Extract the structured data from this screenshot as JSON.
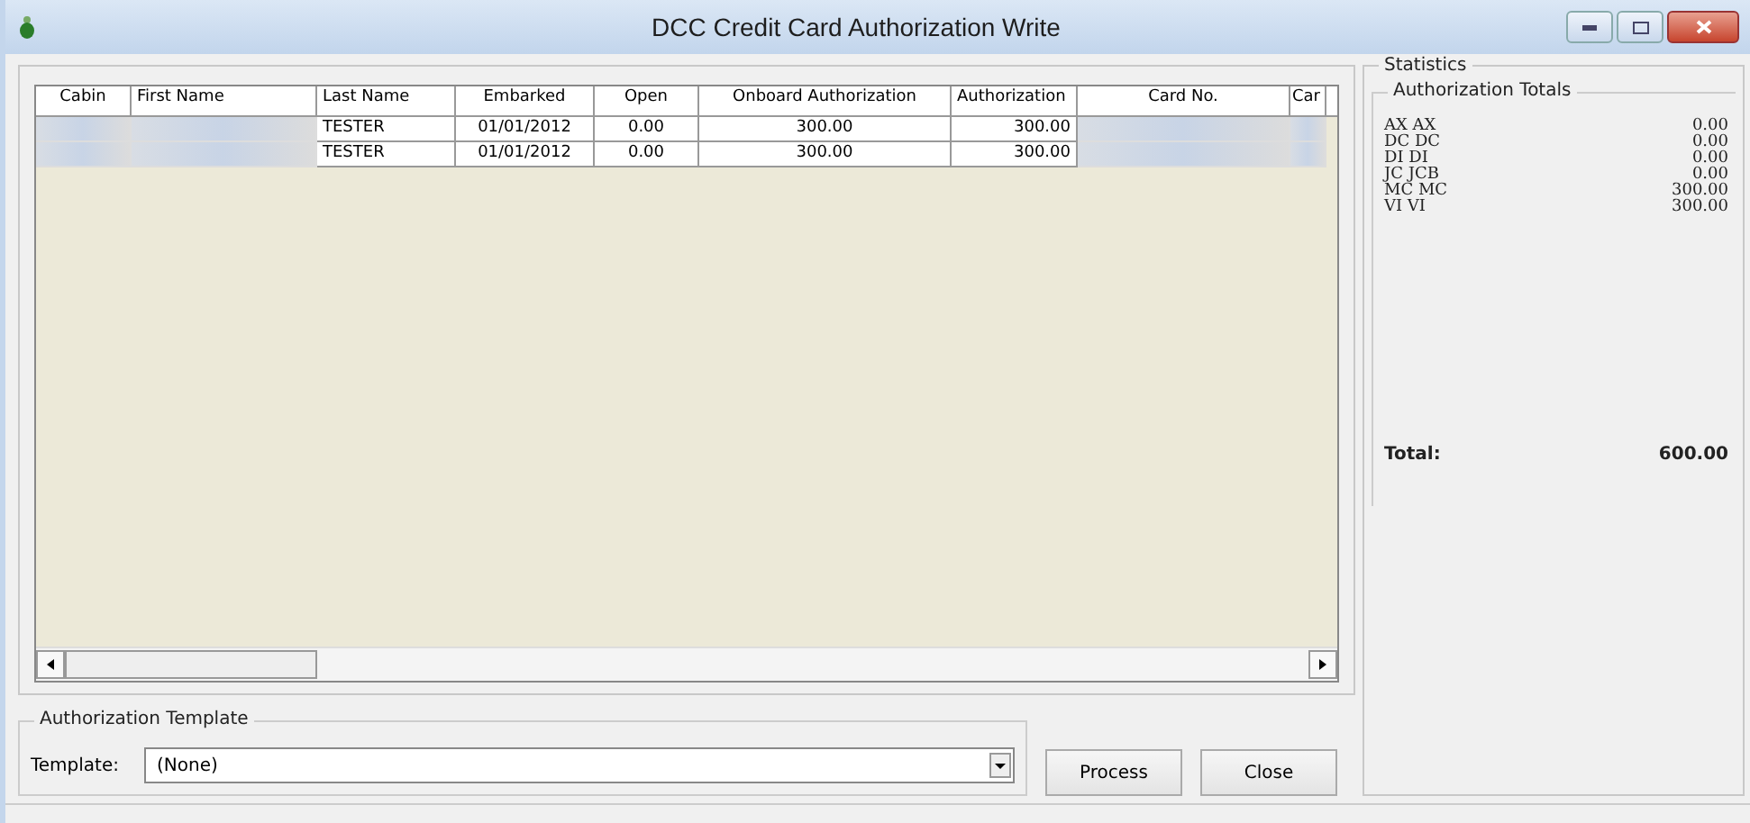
{
  "window": {
    "title": "DCC Credit Card Authorization Write"
  },
  "table": {
    "columns": [
      "Cabin",
      "First Name",
      "Last Name",
      "Embarked",
      "Open",
      "Onboard Authorization",
      "Authorization",
      "Card No.",
      "Car"
    ],
    "rows": [
      {
        "cells": [
          null,
          null,
          "TESTER",
          "01/01/2012",
          "0.00",
          "300.00",
          "300.00",
          null,
          null
        ]
      },
      {
        "cells": [
          null,
          null,
          "TESTER",
          "01/01/2012",
          "0.00",
          "300.00",
          "300.00",
          null,
          null
        ]
      }
    ]
  },
  "template_group": {
    "title": "Authorization Template",
    "label": "Template:",
    "value": "(None)"
  },
  "buttons": [
    "Process",
    "Close"
  ],
  "statistics": {
    "title": "Statistics",
    "totals_title": "Authorization Totals",
    "items": [
      {
        "code": "AX AX",
        "amount": "0.00"
      },
      {
        "code": "DC DC",
        "amount": "0.00"
      },
      {
        "code": "DI DI",
        "amount": "0.00"
      },
      {
        "code": "JC JCB",
        "amount": "0.00"
      },
      {
        "code": "MC MC",
        "amount": "300.00"
      },
      {
        "code": "VI VI",
        "amount": "300.00"
      }
    ],
    "total_label": "Total:",
    "total_value": "600.00"
  }
}
